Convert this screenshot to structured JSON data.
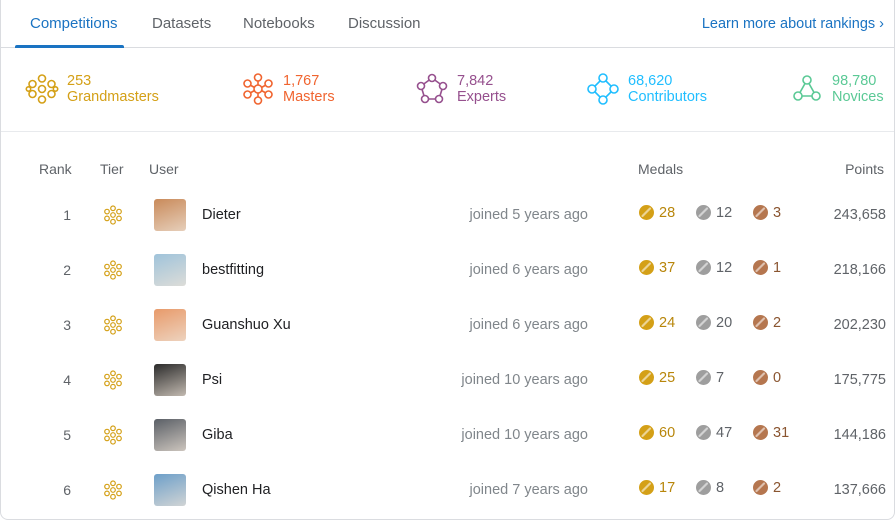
{
  "tabs": [
    {
      "label": "Competitions",
      "active": true
    },
    {
      "label": "Datasets",
      "active": false
    },
    {
      "label": "Notebooks",
      "active": false
    },
    {
      "label": "Discussion",
      "active": false
    }
  ],
  "learn_more": "Learn more about rankings ›",
  "summary": [
    {
      "count": "253",
      "label": "Grandmasters",
      "color": "#d4a017",
      "icon": "grandmaster-icon"
    },
    {
      "count": "1,767",
      "label": "Masters",
      "color": "#f0642f",
      "icon": "master-icon"
    },
    {
      "count": "7,842",
      "label": "Experts",
      "color": "#96508e",
      "icon": "expert-icon"
    },
    {
      "count": "68,620",
      "label": "Contributors",
      "color": "#20beff",
      "icon": "contributor-icon"
    },
    {
      "count": "98,780",
      "label": "Novices",
      "color": "#5ac995",
      "icon": "novice-icon"
    }
  ],
  "columns": {
    "rank": "Rank",
    "tier": "Tier",
    "user": "User",
    "medals": "Medals",
    "points": "Points"
  },
  "medal_colors": {
    "gold": "#d4a017",
    "silver": "#9e9e9e",
    "bronze": "#b5764f"
  },
  "rows": [
    {
      "rank": "1",
      "name": "Dieter",
      "joined": "joined 5 years ago",
      "gold": "28",
      "silver": "12",
      "bronze": "3",
      "points": "243,658",
      "avatar": "#c98a5a"
    },
    {
      "rank": "2",
      "name": "bestfitting",
      "joined": "joined 6 years ago",
      "gold": "37",
      "silver": "12",
      "bronze": "1",
      "points": "218,166",
      "avatar": "#9fc3da"
    },
    {
      "rank": "3",
      "name": "Guanshuo Xu",
      "joined": "joined 6 years ago",
      "gold": "24",
      "silver": "20",
      "bronze": "2",
      "points": "202,230",
      "avatar": "#e89a6a"
    },
    {
      "rank": "4",
      "name": "Psi",
      "joined": "joined 10 years ago",
      "gold": "25",
      "silver": "7",
      "bronze": "0",
      "points": "175,775",
      "avatar": "#2b2b2b"
    },
    {
      "rank": "5",
      "name": "Giba",
      "joined": "joined 10 years ago",
      "gold": "60",
      "silver": "47",
      "bronze": "31",
      "points": "144,186",
      "avatar": "#5a5f66"
    },
    {
      "rank": "6",
      "name": "Qishen Ha",
      "joined": "joined 7 years ago",
      "gold": "17",
      "silver": "8",
      "bronze": "2",
      "points": "137,666",
      "avatar": "#6d9fc9"
    }
  ]
}
